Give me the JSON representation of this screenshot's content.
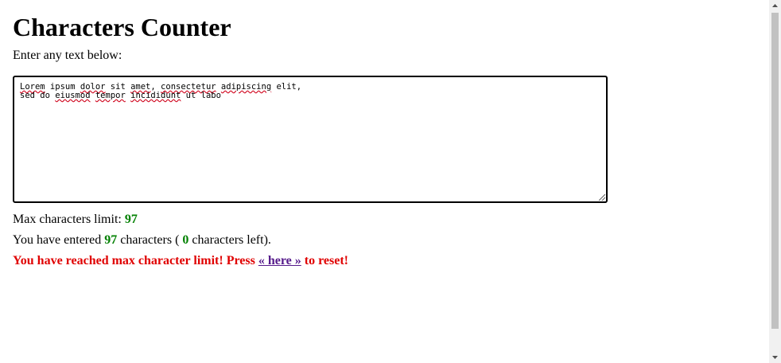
{
  "page": {
    "title": "Characters Counter",
    "intro": "Enter any text below:"
  },
  "textarea": {
    "line1_words": [
      "Lorem",
      " ipsum ",
      "dolor",
      " sit ",
      "amet",
      ", ",
      "consectetur",
      " ",
      "adipiscing",
      " elit,"
    ],
    "line2_words": [
      "sed do ",
      "eiusmod",
      " ",
      "tempor",
      " ",
      "incididunt",
      " ut labo"
    ]
  },
  "limit": {
    "label": "Max characters limit:",
    "value": "97"
  },
  "entered": {
    "prefix": "You have entered",
    "count": "97",
    "middle": "characters (",
    "left": "0",
    "suffix": "characters left)."
  },
  "warning": {
    "prefix": "You have reached max character limit! Press",
    "link": "« here »",
    "suffix": "to reset!"
  },
  "colors": {
    "count": "#008000",
    "warning": "#e00000",
    "link": "#551a8b"
  }
}
